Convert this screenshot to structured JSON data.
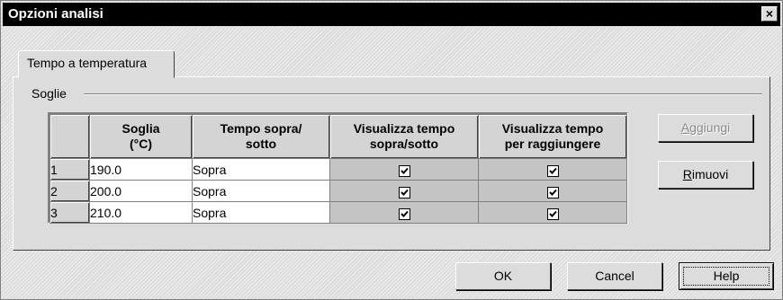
{
  "window": {
    "title": "Opzioni analisi",
    "close_glyph": "×"
  },
  "tabs": [
    {
      "label": "Tempo a temperatura"
    }
  ],
  "group": {
    "label": "Soglie"
  },
  "grid": {
    "headers": {
      "soglia": [
        "Soglia",
        "(°C)"
      ],
      "tempo": [
        "Tempo sopra/",
        "sotto"
      ],
      "visualizza": [
        "Visualizza tempo",
        "sopra/sotto"
      ],
      "raggiungere": [
        "Visualizza tempo",
        "per raggiungere"
      ]
    },
    "rows": [
      {
        "num": "1",
        "soglia": "190.0",
        "tempo": "Sopra",
        "visualizza": true,
        "raggiungere": true
      },
      {
        "num": "2",
        "soglia": "200.0",
        "tempo": "Sopra",
        "visualizza": true,
        "raggiungere": true
      },
      {
        "num": "3",
        "soglia": "210.0",
        "tempo": "Sopra",
        "visualizza": true,
        "raggiungere": true
      }
    ]
  },
  "side_buttons": {
    "aggiungi": {
      "first": "A",
      "rest": "ggiungi",
      "enabled": false
    },
    "rimuovi": {
      "first": "R",
      "rest": "imuovi",
      "enabled": true
    }
  },
  "footer": {
    "ok": "OK",
    "cancel": "Cancel",
    "help": "Help"
  },
  "icons": {
    "close": "close-icon",
    "check": "checkmark-icon"
  }
}
